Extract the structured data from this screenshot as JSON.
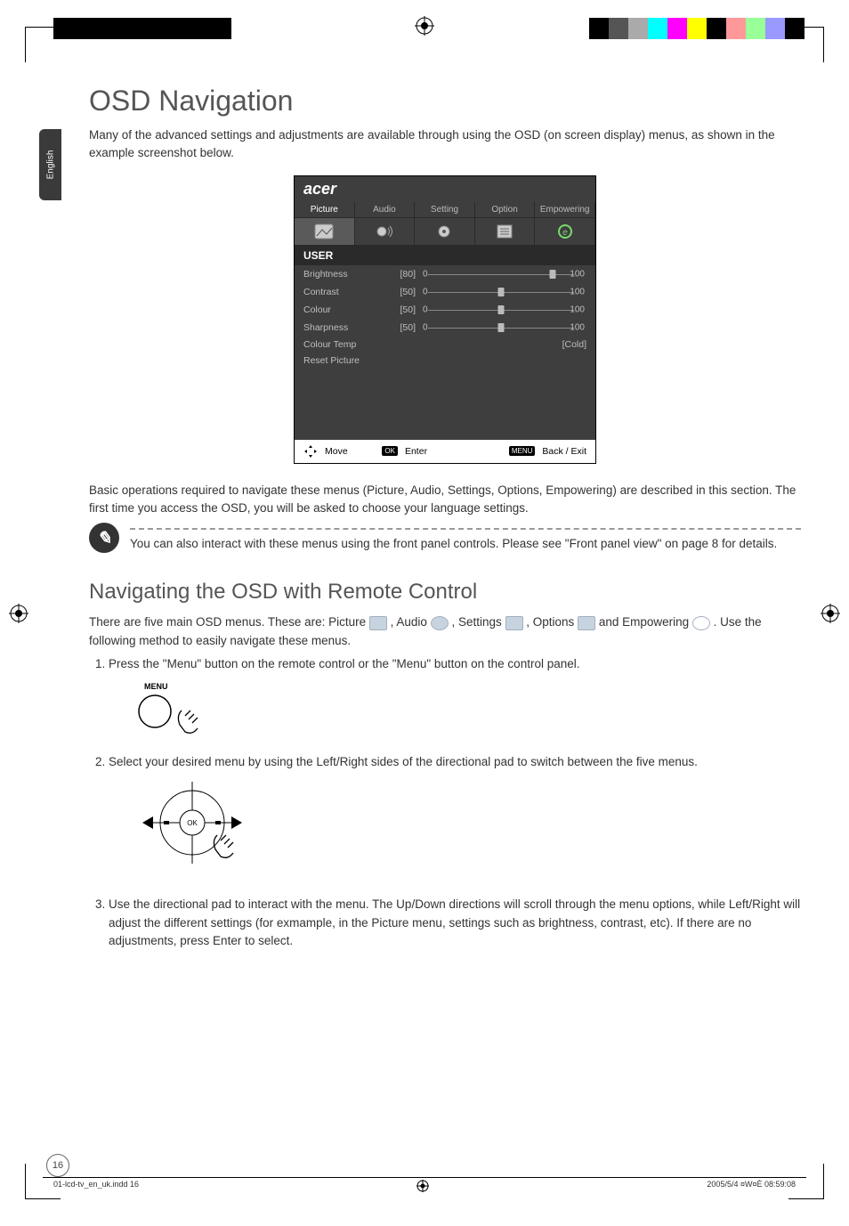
{
  "language_tab": "English",
  "title": "OSD Navigation",
  "intro": "Many of the advanced settings and adjustments are available through using the OSD (on screen display) menus, as shown in the example screenshot below.",
  "osd": {
    "brand": "acer",
    "tabs": [
      "Picture",
      "Audio",
      "Setting",
      "Option",
      "Empowering"
    ],
    "section": "USER",
    "rows": [
      {
        "label": "Brightness",
        "value": "[80]",
        "pos": 80,
        "min": "0",
        "max": "100"
      },
      {
        "label": "Contrast",
        "value": "[50]",
        "pos": 50,
        "min": "0",
        "max": "100"
      },
      {
        "label": "Colour",
        "value": "[50]",
        "pos": 50,
        "min": "0",
        "max": "100"
      },
      {
        "label": "Sharpness",
        "value": "[50]",
        "pos": 50,
        "min": "0",
        "max": "100"
      }
    ],
    "colour_temp": {
      "label": "Colour Temp",
      "value": "[Cold]"
    },
    "reset_label": "Reset Picture",
    "foot": {
      "move": "Move",
      "ok": "OK",
      "enter": "Enter",
      "menu": "MENU",
      "back": "Back / Exit"
    }
  },
  "body2": "Basic operations required to navigate these menus (Picture, Audio, Settings, Options, Empowering) are described in this section. The first time you access the OSD, you will be asked to choose your language settings.",
  "note": "You can also interact with these menus using the front panel controls. Please see \"Front panel view\" on page 8 for details.",
  "h2": "Navigating the OSD with Remote Control",
  "menus_intro_a": "There are five main OSD menus. These are: Picture ",
  "menus_intro_b": ", Audio ",
  "menus_intro_c": ", Settings ",
  "menus_intro_d": ", Options ",
  "menus_intro_e": " and Empowering ",
  "menus_intro_f": " . Use the following method to easily navigate these menus.",
  "steps": [
    "Press the \"Menu\" button on the remote control or the \"Menu\" button on the control panel.",
    "Select your desired menu by using the Left/Right sides of the directional pad to switch between the five menus.",
    "Use the directional pad to interact with the menu. The Up/Down directions will scroll through the menu options, while Left/Right will adjust the different settings (for exmample, in the Picture menu, settings such as brightness, contrast, etc). If there are no adjustments, press Enter to select."
  ],
  "menu_btn_label": "MENU",
  "dpad_ok": "OK",
  "page_number": "16",
  "footer_left": "01-lcd-tv_en_uk.indd   16",
  "footer_right": "2005/5/4   ¤W¤È 08:59:08"
}
